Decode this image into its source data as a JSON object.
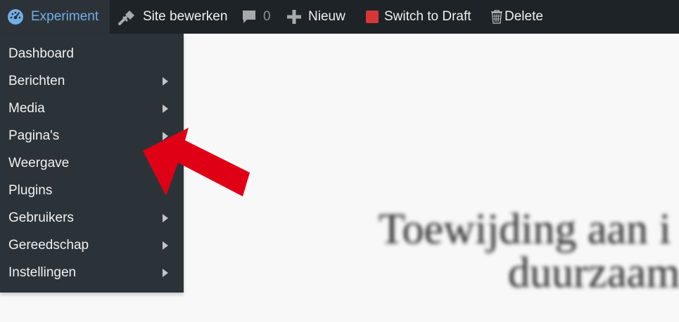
{
  "adminbar": {
    "site_label": "Experiment",
    "edit_label": "Site bewerken",
    "comments_count": "0",
    "new_label": "Nieuw",
    "draft_label": "Switch to Draft",
    "delete_label": "Delete",
    "site_color": "#72aee6",
    "draft_color": "#d63638"
  },
  "menu": {
    "items": [
      {
        "label": "Dashboard",
        "submenu": false
      },
      {
        "label": "Berichten",
        "submenu": true
      },
      {
        "label": "Media",
        "submenu": true
      },
      {
        "label": "Pagina's",
        "submenu": true
      },
      {
        "label": "Weergave",
        "submenu": false
      },
      {
        "label": "Plugins",
        "submenu": false
      },
      {
        "label": "Gebruikers",
        "submenu": true
      },
      {
        "label": "Gereedschap",
        "submenu": true
      },
      {
        "label": "Instellingen",
        "submenu": true
      }
    ]
  },
  "page": {
    "headline_line1": "Toewijding aan i",
    "headline_line2": "duurzaam"
  },
  "annotation": {
    "color": "#e00016",
    "icon": "red-arrow-icon"
  }
}
